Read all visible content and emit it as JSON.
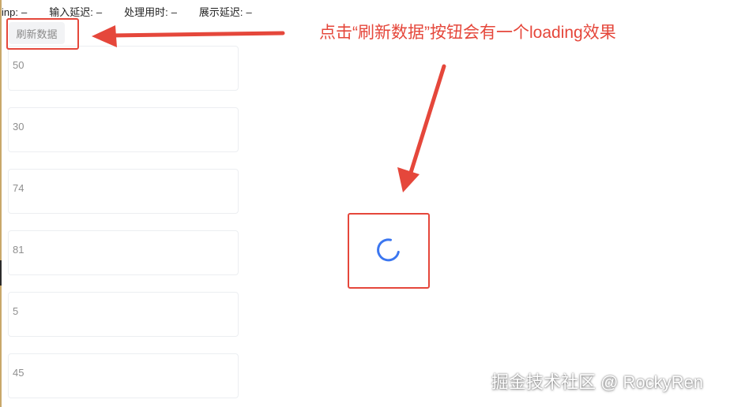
{
  "metrics": [
    {
      "label": "inp:",
      "value": "–"
    },
    {
      "label": "输入延迟:",
      "value": "–"
    },
    {
      "label": "处理用时:",
      "value": "–"
    },
    {
      "label": "展示延迟:",
      "value": "–"
    }
  ],
  "refresh_button": {
    "label": "刷新数据"
  },
  "items": [
    "50",
    "30",
    "74",
    "81",
    "5",
    "45"
  ],
  "annotation": {
    "text": "点击“刷新数据”按钮会有一个loading效果"
  },
  "watermark": {
    "text": "掘金技术社区 @ RockyRen"
  },
  "colors": {
    "annotation_red": "#e5473b",
    "spinner_blue": "#3b76f0",
    "button_bg": "#f2f3f5",
    "card_border": "#eceef1"
  },
  "icons": {
    "spinner": "loading-spinner-icon",
    "arrows": "arrow-annotation-icon"
  }
}
